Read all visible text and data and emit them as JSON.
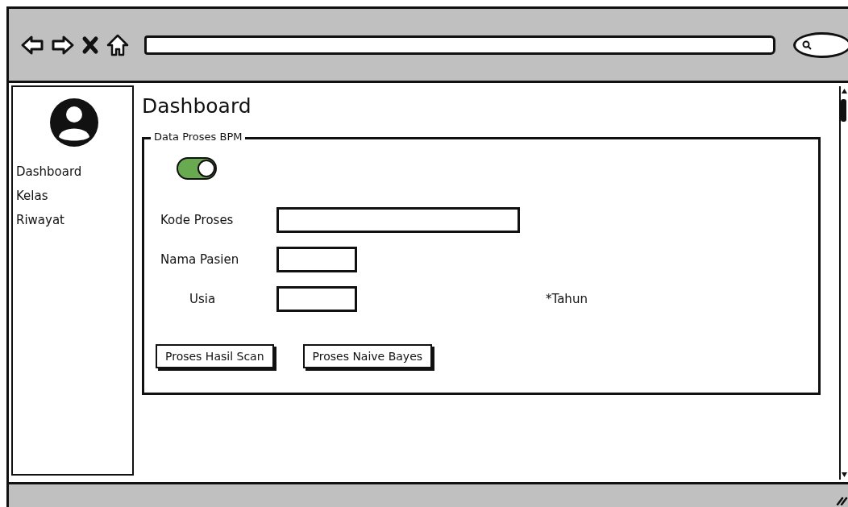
{
  "browser": {
    "search": {
      "kind": "search"
    }
  },
  "sidebar": {
    "items": [
      {
        "label": "Dashboard"
      },
      {
        "label": "Kelas"
      },
      {
        "label": "Riwayat"
      }
    ]
  },
  "main": {
    "title": "Dashboard",
    "group": {
      "legend": "Data Proses BPM",
      "toggle": {
        "on": true
      },
      "fields": [
        {
          "label": "Kode Proses",
          "kind": "long",
          "indented": false
        },
        {
          "label": "Nama Pasien",
          "kind": "short",
          "indented": false
        },
        {
          "label": "Usia",
          "kind": "short",
          "indented": true,
          "note": "*Tahun"
        }
      ],
      "buttons": [
        "Proses Hasil Scan",
        "Proses Naive Bayes"
      ]
    }
  }
}
